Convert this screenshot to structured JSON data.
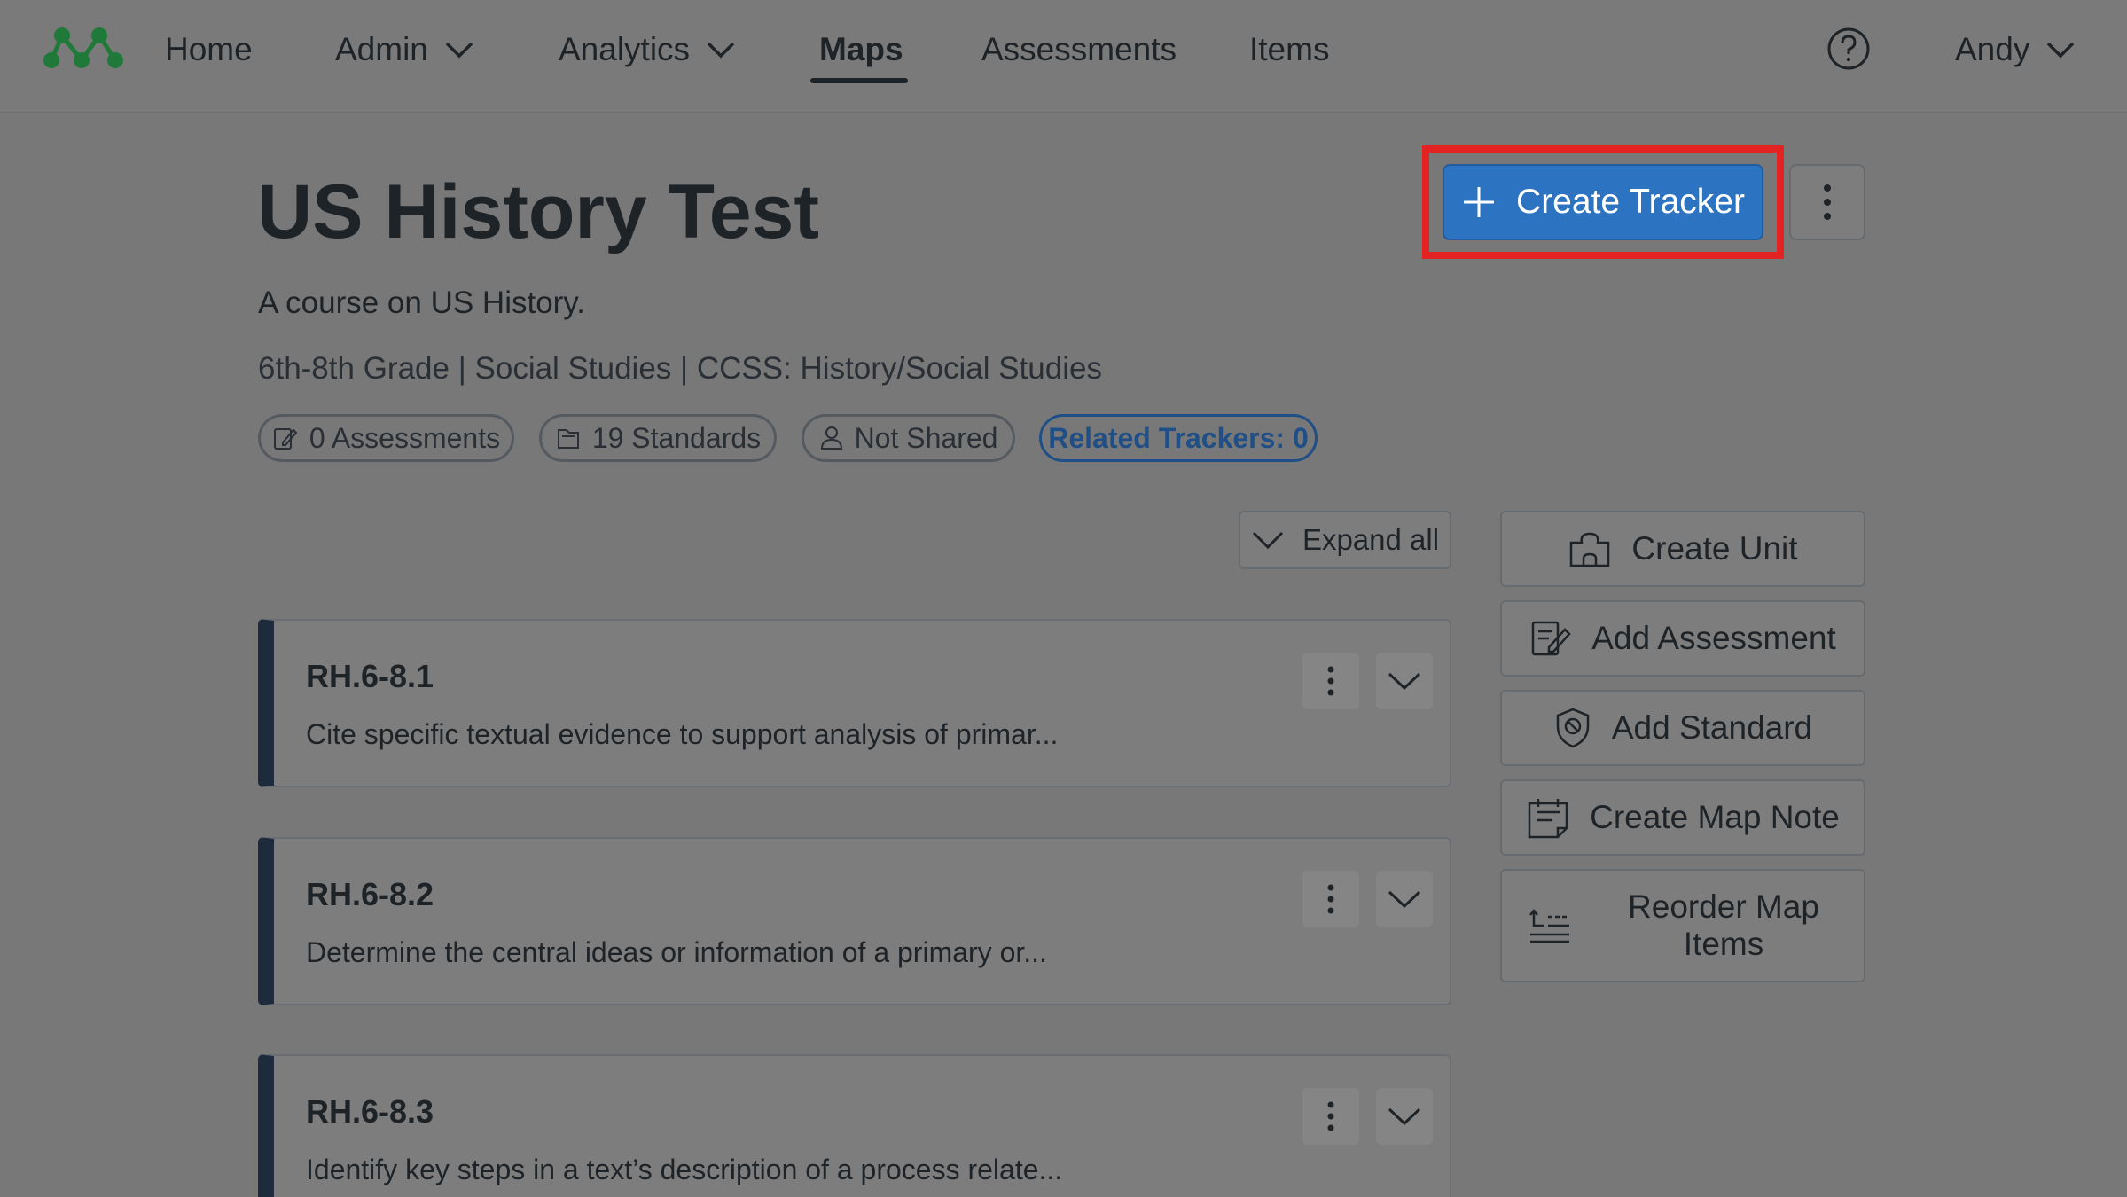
{
  "nav": {
    "logo_icon": "network-logo-icon",
    "items": [
      {
        "label": "Home"
      },
      {
        "label": "Admin"
      },
      {
        "label": "Analytics"
      },
      {
        "label": "Maps"
      },
      {
        "label": "Assessments"
      },
      {
        "label": "Items"
      }
    ],
    "active": "Maps",
    "help_icon": "help-circle-icon",
    "user": "Andy"
  },
  "header": {
    "title": "US History Test",
    "subtitle": "A course on US History.",
    "meta": "6th-8th Grade | Social Studies | CCSS: History/Social Studies",
    "pills": {
      "assessments": "0 Assessments",
      "standards": "19 Standards",
      "sharing": "Not Shared",
      "related": "Related Trackers: 0"
    },
    "create_tracker_label": "Create Tracker"
  },
  "expand_all_label": "Expand all",
  "standards": [
    {
      "code": "RH.6-8.1",
      "description": "Cite specific textual evidence to support analysis of primar..."
    },
    {
      "code": "RH.6-8.2",
      "description": "Determine the central ideas or information of a primary or..."
    },
    {
      "code": "RH.6-8.3",
      "description": "Identify key steps in a text’s description of a process relate..."
    }
  ],
  "actions": {
    "create_unit": "Create Unit",
    "add_assessment": "Add Assessment",
    "add_standard": "Add Standard",
    "create_map_note": "Create Map Note",
    "reorder_map_items": "Reorder Map\nItems"
  },
  "colors": {
    "primary": "#2c73c1",
    "highlight": "#e32222",
    "card_accent": "#1d2b3d",
    "logo": "#1f7a3a",
    "related_link": "#1f4f86"
  }
}
